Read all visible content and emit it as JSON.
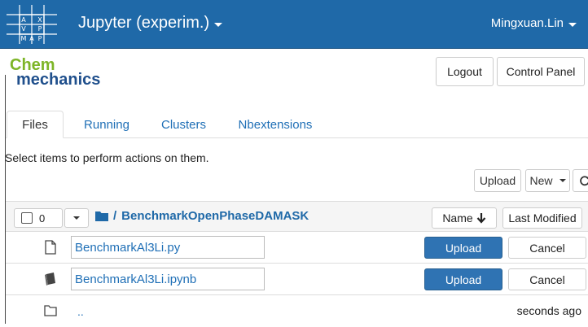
{
  "navbar": {
    "logo_letters": [
      "A",
      "I",
      "X",
      "V",
      "I",
      "P",
      "M",
      "A",
      "P"
    ],
    "brand": "Jupyter (experim.)",
    "user": "Mingxuan.Lin",
    "color": "#1f69a8"
  },
  "header": {
    "logo_top": "Chem",
    "logo_bottom": "mechanics",
    "logout": "Logout",
    "control_panel": "Control Panel"
  },
  "tabs": [
    {
      "label": "Files",
      "active": true
    },
    {
      "label": "Running"
    },
    {
      "label": "Clusters"
    },
    {
      "label": "Nbextensions"
    }
  ],
  "instructions": "Select items to perform actions on them.",
  "toolbar": {
    "upload": "Upload",
    "new": "New",
    "refresh_icon": "refresh-icon"
  },
  "list_header": {
    "selected_count": "0",
    "path_sep": "/",
    "folder": "BenchmarkOpenPhaseDAMASK",
    "sort_name": "Name",
    "last_modified": "Last Modified"
  },
  "rows": [
    {
      "icon": "file-icon",
      "value": "BenchmarkAl3Li.py",
      "upload": "Upload",
      "cancel": "Cancel"
    },
    {
      "icon": "notebook-icon",
      "value": "BenchmarkAl3Li.ipynb",
      "upload": "Upload",
      "cancel": "Cancel"
    }
  ],
  "parent_row": {
    "name": "..",
    "time": "seconds ago"
  }
}
